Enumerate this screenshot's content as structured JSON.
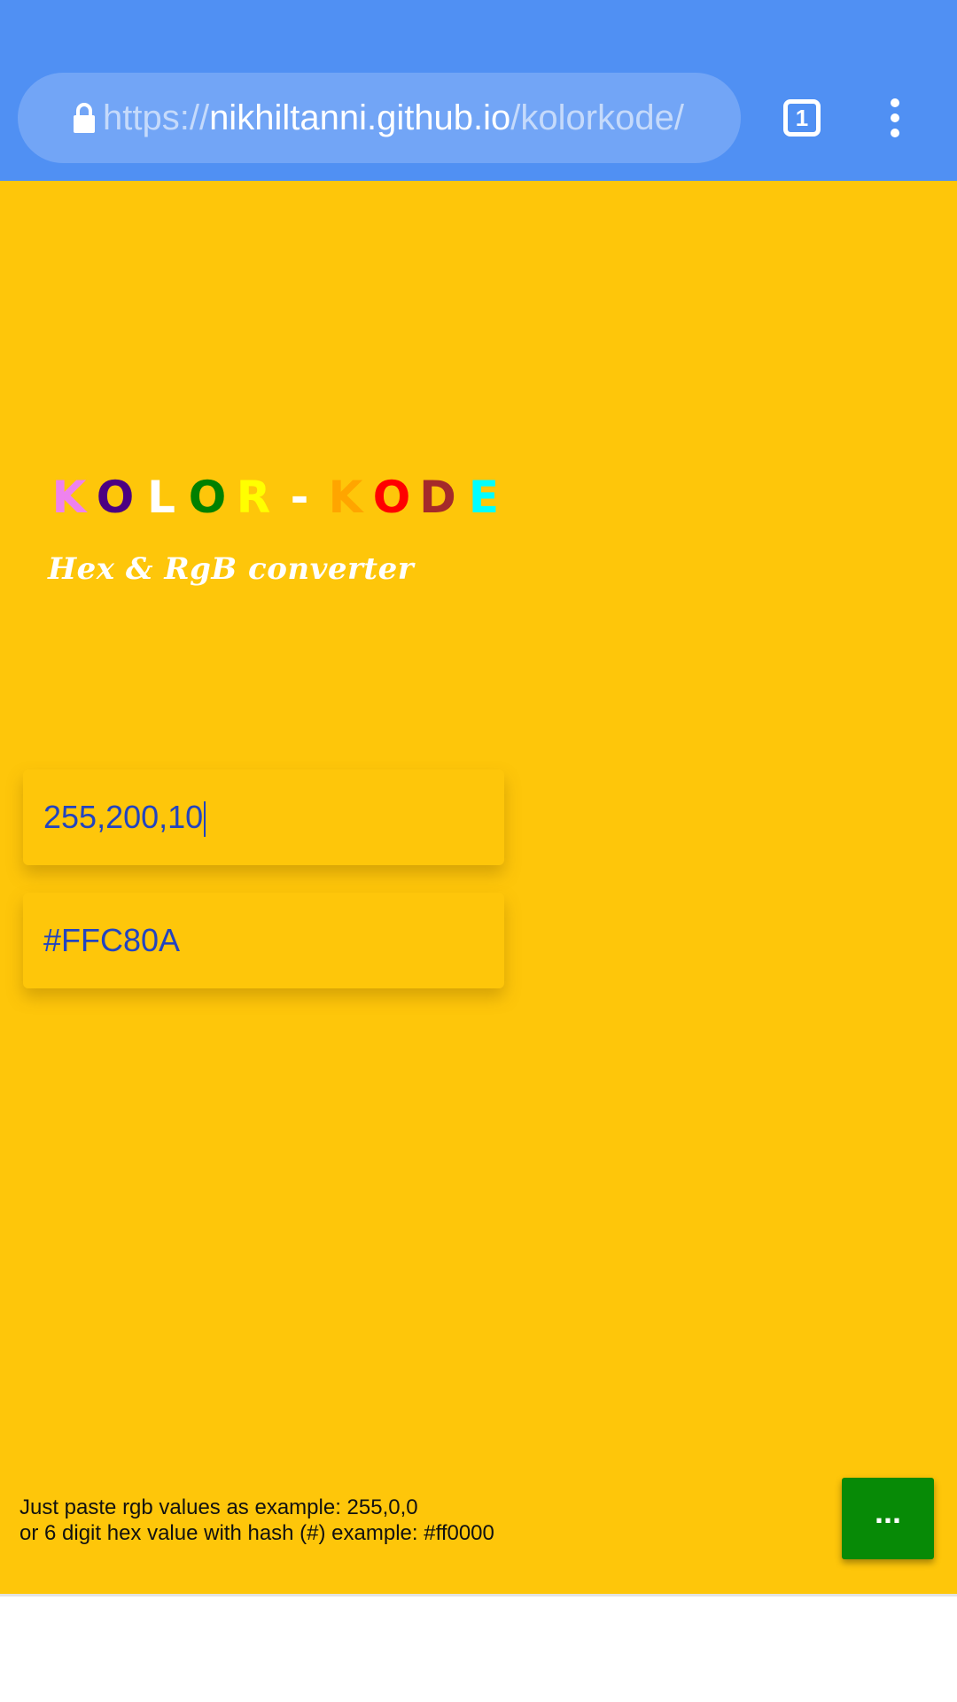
{
  "browser": {
    "url_scheme": "https://",
    "url_host": "nikhiltanni.github.io",
    "url_path": "/kolorkode/",
    "tab_count": "1",
    "bar_color": "#5090f3"
  },
  "app": {
    "title_letters": [
      {
        "ch": "K",
        "color": "#ee82ee"
      },
      {
        "ch": "O",
        "color": "#4b0082"
      },
      {
        "ch": "L",
        "color": "#ffffff"
      },
      {
        "ch": "O",
        "color": "#008000"
      },
      {
        "ch": "R",
        "color": "#ffff00"
      },
      {
        "ch": "-",
        "color": "#ffffff"
      },
      {
        "ch": "K",
        "color": "#ffa500"
      },
      {
        "ch": "O",
        "color": "#ff0000"
      },
      {
        "ch": "D",
        "color": "#a52a2a"
      },
      {
        "ch": "E",
        "color": "#00ffff"
      }
    ],
    "tagline": "Hex & RgB converter",
    "rgb_value": "255,200,10",
    "hex_value": "#FFC80A",
    "instructions_line1": "Just paste rgb values as example: 255,0,0",
    "instructions_line2": "or 6 digit hex value with hash (#) example: #ff0000",
    "menu_button_label": "...",
    "background_color": "#fec60a",
    "button_color": "#078a06"
  }
}
